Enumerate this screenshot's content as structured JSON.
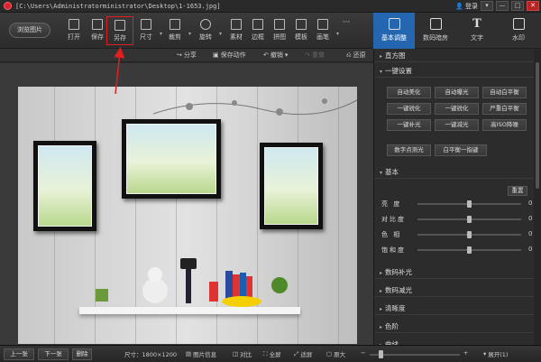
{
  "window": {
    "title": "[C:\\Users\\Administratorministrator\\Desktop\\1-1653.jpg]",
    "login": "登录",
    "controls": [
      "▾",
      "—",
      "□",
      "✕"
    ]
  },
  "toolbar": {
    "browse": "浏览图片",
    "tools": [
      "打开",
      "保存",
      "另存",
      "尺寸",
      "裁剪",
      "旋转",
      "素材",
      "边框",
      "拼图",
      "模板",
      "画笔"
    ],
    "more": "···"
  },
  "right_tabs": [
    "基本调整",
    "数码暗房",
    "文字",
    "水印"
  ],
  "subbar": {
    "share": "分享",
    "save_action": "保存动作",
    "undo": "撤销",
    "redo": "重做",
    "restore": "还原"
  },
  "panel": {
    "histogram": "直方图",
    "one_click": "一键设置",
    "presets": [
      "自动美化",
      "自动曝光",
      "自动白平衡",
      "一键锐化",
      "一键锐化",
      "严重白平衡",
      "一键补光",
      "一键减光",
      "高ISO降噪"
    ],
    "extra_presets": [
      "数字点测光",
      "白平衡一指键"
    ],
    "basic": "基本",
    "reset": "重置",
    "sliders": [
      {
        "label": "亮 度",
        "value": "0"
      },
      {
        "label": "对比度",
        "value": "0"
      },
      {
        "label": "色 相",
        "value": "0"
      },
      {
        "label": "饱和度",
        "value": "0"
      }
    ],
    "collapsed": [
      "数码补光",
      "数码减光",
      "清晰度",
      "色阶",
      "曲线"
    ]
  },
  "status": {
    "prev": "上一张",
    "next": "下一张",
    "delete": "删除",
    "size": "尺寸：1800×1200",
    "info": "图片信息",
    "compare": "对比",
    "fullscreen": "全屏",
    "fit": "适屏",
    "original": "原大",
    "expand": "展开(1)"
  },
  "colors": {
    "accent": "#2467b0",
    "highlight": "#e02020"
  }
}
